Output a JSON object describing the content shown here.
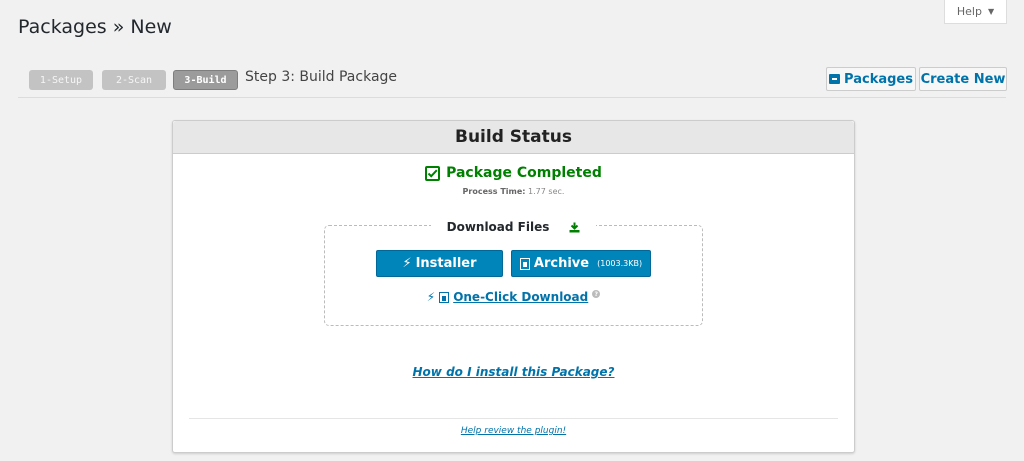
{
  "help": {
    "label": "Help"
  },
  "page": {
    "title": "Packages » New"
  },
  "steps": {
    "step1": "1-Setup",
    "step2": "2-Scan",
    "step3": "3-Build",
    "current_label": "Step 3: Build Package"
  },
  "toolbar": {
    "packages_label": "Packages",
    "create_new_label": "Create New"
  },
  "panel": {
    "title": "Build Status",
    "status": "Package Completed",
    "process_time_label": "Process Time:",
    "process_time_value": "1.77 sec.",
    "download": {
      "legend": "Download Files",
      "installer_label": "Installer",
      "archive_label": "Archive",
      "archive_size": "(1003.3KB)",
      "oneclick_label": "One-Click Download"
    },
    "howto_label": "How do I install this Package?",
    "review_label": "Help review the plugin!"
  },
  "colors": {
    "accent": "#0073aa",
    "primary_button": "#0085ba",
    "success": "#008000"
  }
}
